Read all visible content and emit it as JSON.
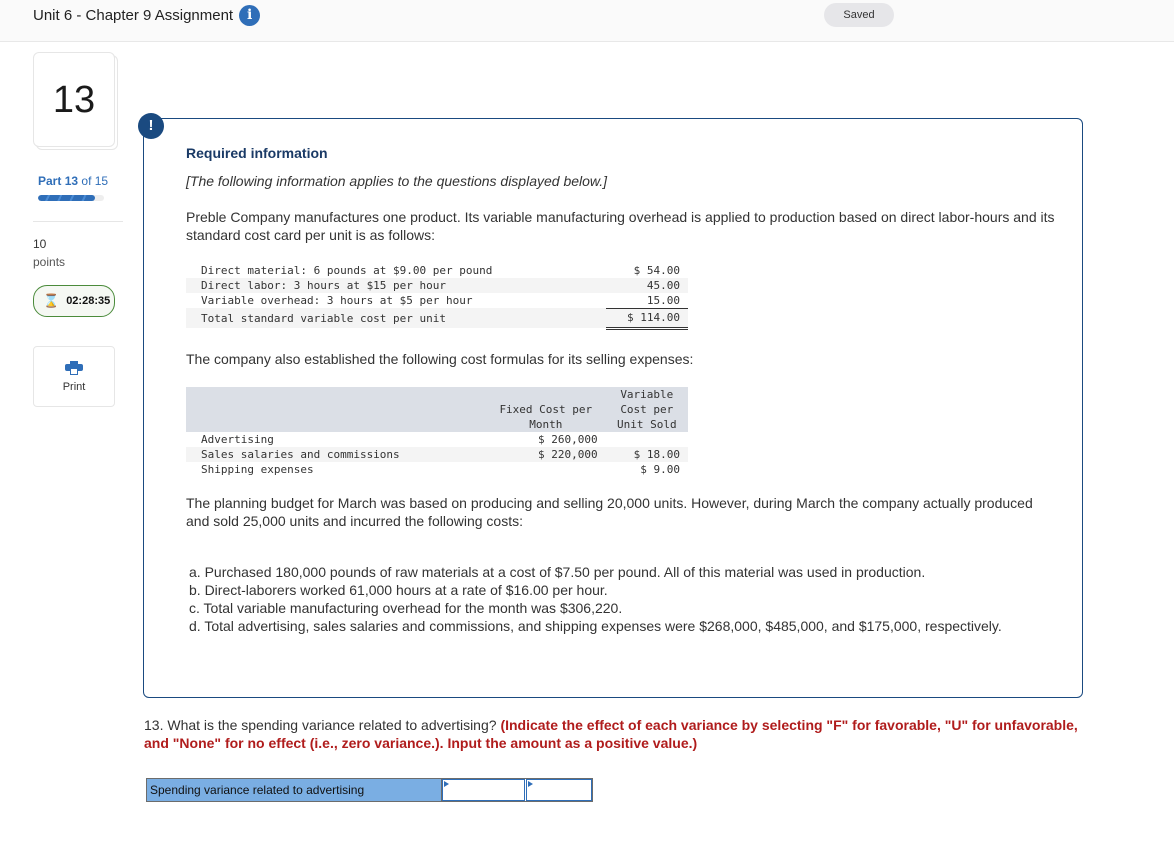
{
  "header": {
    "title": "Unit 6 - Chapter 9 Assignment",
    "info_icon": "info-icon",
    "saved_label": "Saved"
  },
  "sidebar": {
    "question_number": "13",
    "part_prefix": "Part",
    "part_current": "13",
    "part_suffix": "of 15",
    "progress_fraction": 0.867,
    "points_value": "10",
    "points_label": "points",
    "timer": "02:28:35",
    "timer_icon": "hourglass-icon",
    "print_label": "Print",
    "print_icon": "printer-icon"
  },
  "info": {
    "alert_icon": "!",
    "title": "Required information",
    "subtitle": "[The following information applies to the questions displayed below.]",
    "intro": "Preble Company manufactures one product. Its variable manufacturing overhead is applied to production based on direct labor-hours and its standard cost card per unit is as follows:",
    "cost_card": [
      {
        "label": "Direct material: 6 pounds at $9.00 per pound",
        "value": "$ 54.00"
      },
      {
        "label": "Direct labor: 3 hours at $15 per hour",
        "value": "45.00"
      },
      {
        "label": "Variable overhead: 3 hours at $5 per hour",
        "value": "15.00"
      },
      {
        "label": "Total standard variable cost per unit",
        "value": "$ 114.00"
      }
    ],
    "selling_intro": "The company also established the following cost formulas for its selling expenses:",
    "selling_headers": {
      "fixed_line1": "Fixed Cost per",
      "fixed_line2": "Month",
      "var_line1": "Variable",
      "var_line2": "Cost per",
      "var_line3": "Unit Sold"
    },
    "selling_rows": [
      {
        "label": "Advertising",
        "fixed": "$ 260,000",
        "variable": ""
      },
      {
        "label": "Sales salaries and commissions",
        "fixed": "$ 220,000",
        "variable": "$ 18.00"
      },
      {
        "label": "Shipping expenses",
        "fixed": "",
        "variable": "$ 9.00"
      }
    ],
    "planning_text": "The planning budget for March was based on producing and selling 20,000 units. However, during March the company actually produced and sold 25,000 units and incurred the following costs:",
    "actuals": [
      "a. Purchased 180,000 pounds of raw materials at a cost of $7.50 per pound. All of this material was used in production.",
      "b. Direct-laborers worked 61,000 hours at a rate of $16.00 per hour.",
      "c. Total variable manufacturing overhead for the month was $306,220.",
      "d. Total advertising, sales salaries and commissions, and shipping expenses were $268,000, $485,000, and $175,000, respectively."
    ]
  },
  "question": {
    "text": "13. What is the spending variance related to advertising?",
    "instructions": "(Indicate the effect of each variance by selecting \"F\" for favorable, \"U\" for unfavorable, and \"None\" for no effect (i.e., zero variance.). Input the amount as a positive value.)",
    "answer_label": "Spending variance related to advertising",
    "amount_value": "",
    "effect_value": ""
  }
}
